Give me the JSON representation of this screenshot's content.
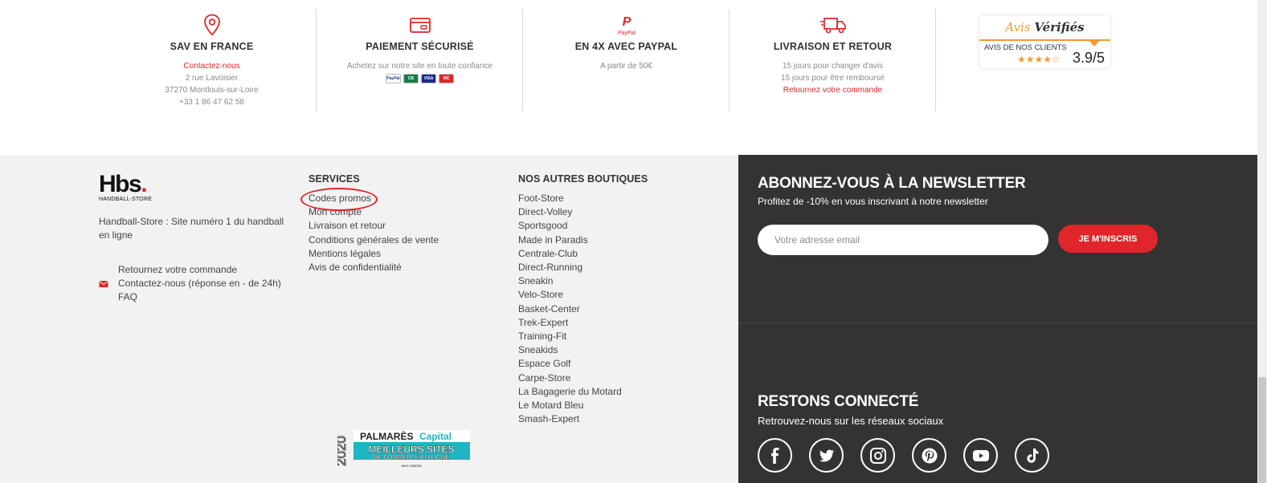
{
  "reassurance": {
    "sav": {
      "title": "SAV EN FRANCE",
      "link": "Contactez-nous",
      "address1": "2 rue Lavoisier",
      "address2": "37270 Montlouis-sur-Loire",
      "phone": "+33 1 86 47 62 58"
    },
    "payment": {
      "title": "PAIEMENT SÉCURISÉ",
      "text": "Achetez sur notre site en toute confiance",
      "cards": [
        "PayPal",
        "CB",
        "VISA",
        "MC"
      ]
    },
    "paypal": {
      "logo": "PayPal",
      "title": "EN 4X AVEC PAYPAL",
      "text": "A partir de 50€"
    },
    "delivery": {
      "title": "LIVRAISON ET RETOUR",
      "line1": "15 jours pour changer d'avis",
      "line2": "15 jours pour être remboursé",
      "link": "Retournez votre commande"
    },
    "reviews": {
      "brand_part1": "Avis",
      "brand_part2": "Vérifiés",
      "subtitle": "AVIS DE NOS CLIENTS",
      "stars": "★★★★☆",
      "score": "3.9/5"
    }
  },
  "footer": {
    "logo_text": "Hbs",
    "logo_dot": ".",
    "logo_sub": "HANDBALL-STORE",
    "tagline": "Handball-Store : Site numéro 1 du handball en ligne",
    "contact_links": [
      "Retournez votre commande",
      "Contactez-nous (réponse en - de 24h)",
      "FAQ"
    ],
    "services": {
      "title": "SERVICES",
      "items": [
        "Codes promos",
        "Mon compte",
        "Livraison et retour",
        "Conditions générales de vente",
        "Mentions légales",
        "Avis de confidentialité"
      ]
    },
    "boutiques": {
      "title": "NOS AUTRES BOUTIQUES",
      "items": [
        "Foot-Store",
        "Direct-Volley",
        "Sportsgood",
        "Made in Paradis",
        "Centrale-Club",
        "Direct-Running",
        "Sneakin",
        "Velo-Store",
        "Basket-Center",
        "Trek-Expert",
        "Training-Fit",
        "Sneakids",
        "Espace Golf",
        "Carpe-Store",
        "La Bagagerie du Motard",
        "Le Motard Bleu",
        "Smash-Expert"
      ]
    },
    "palmares": {
      "year": "2020",
      "line1a": "PALMARÈS",
      "line1b": "Capital",
      "line2": "MEILLEURS SITES",
      "line3": "DE COMMERCE EN LIGNE",
      "line4": "avec statista"
    }
  },
  "newsletter": {
    "title": "ABONNEZ-VOUS À LA NEWSLETTER",
    "subtitle": "Profitez de -10% en vous inscrivant à notre newsletter",
    "placeholder": "Votre adresse email",
    "button": "JE M'INSCRIS"
  },
  "social": {
    "title": "RESTONS CONNECTÉ",
    "subtitle": "Retrouvez-nous sur les réseaux sociaux",
    "icons": [
      "facebook-icon",
      "twitter-icon",
      "instagram-icon",
      "pinterest-icon",
      "youtube-icon",
      "tiktok-icon"
    ]
  },
  "colors": {
    "accent": "#e0262a",
    "dark": "#333333",
    "light_bg": "#f2f2f2",
    "avis_orange": "#f29a2e"
  }
}
